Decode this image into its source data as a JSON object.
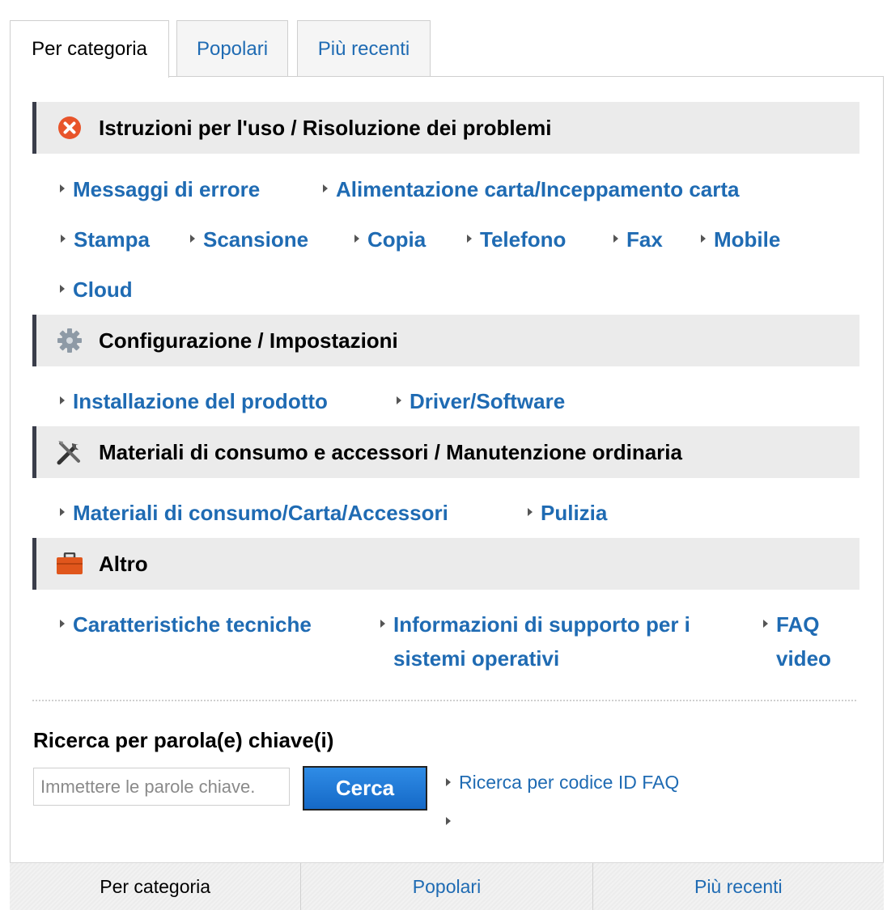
{
  "tabs": [
    {
      "label": "Per categoria",
      "active": true
    },
    {
      "label": "Popolari",
      "active": false
    },
    {
      "label": "Più recenti",
      "active": false
    }
  ],
  "sections": [
    {
      "title": "Istruzioni per l'uso / Risoluzione dei problemi",
      "icon": "error-x-icon",
      "links": [
        "Messaggi di errore",
        "Alimentazione carta/Inceppamento carta",
        "Stampa",
        "Scansione",
        "Copia",
        "Telefono",
        "Fax",
        "Mobile",
        "Cloud"
      ]
    },
    {
      "title": "Configurazione / Impostazioni",
      "icon": "gear-icon",
      "links": [
        "Installazione del prodotto",
        "Driver/Software"
      ]
    },
    {
      "title": "Materiali di consumo e accessori / Manutenzione ordinaria",
      "icon": "tools-icon",
      "links": [
        "Materiali di consumo/Carta/Accessori",
        "Pulizia"
      ]
    },
    {
      "title": "Altro",
      "icon": "toolbox-icon",
      "links": [
        "Caratteristiche tecniche",
        "Informazioni di supporto per i sistemi operativi",
        "FAQ video"
      ]
    }
  ],
  "search": {
    "title": "Ricerca per parola(e) chiave(i)",
    "placeholder": "Immettere le parole chiave.",
    "button_label": "Cerca",
    "faq_id_link": "Ricerca per codice ID FAQ"
  },
  "bottom_tabs": [
    {
      "label": "Per categoria",
      "active": true
    },
    {
      "label": "Popolari",
      "active": false
    },
    {
      "label": "Più recenti",
      "active": false
    }
  ],
  "colors": {
    "link": "#1f6bb3",
    "header_bg": "#ebebeb",
    "header_border": "#3a3d4a",
    "button": "#1f78d6",
    "error_icon": "#e8542a",
    "toolbox_icon": "#e0561c"
  }
}
